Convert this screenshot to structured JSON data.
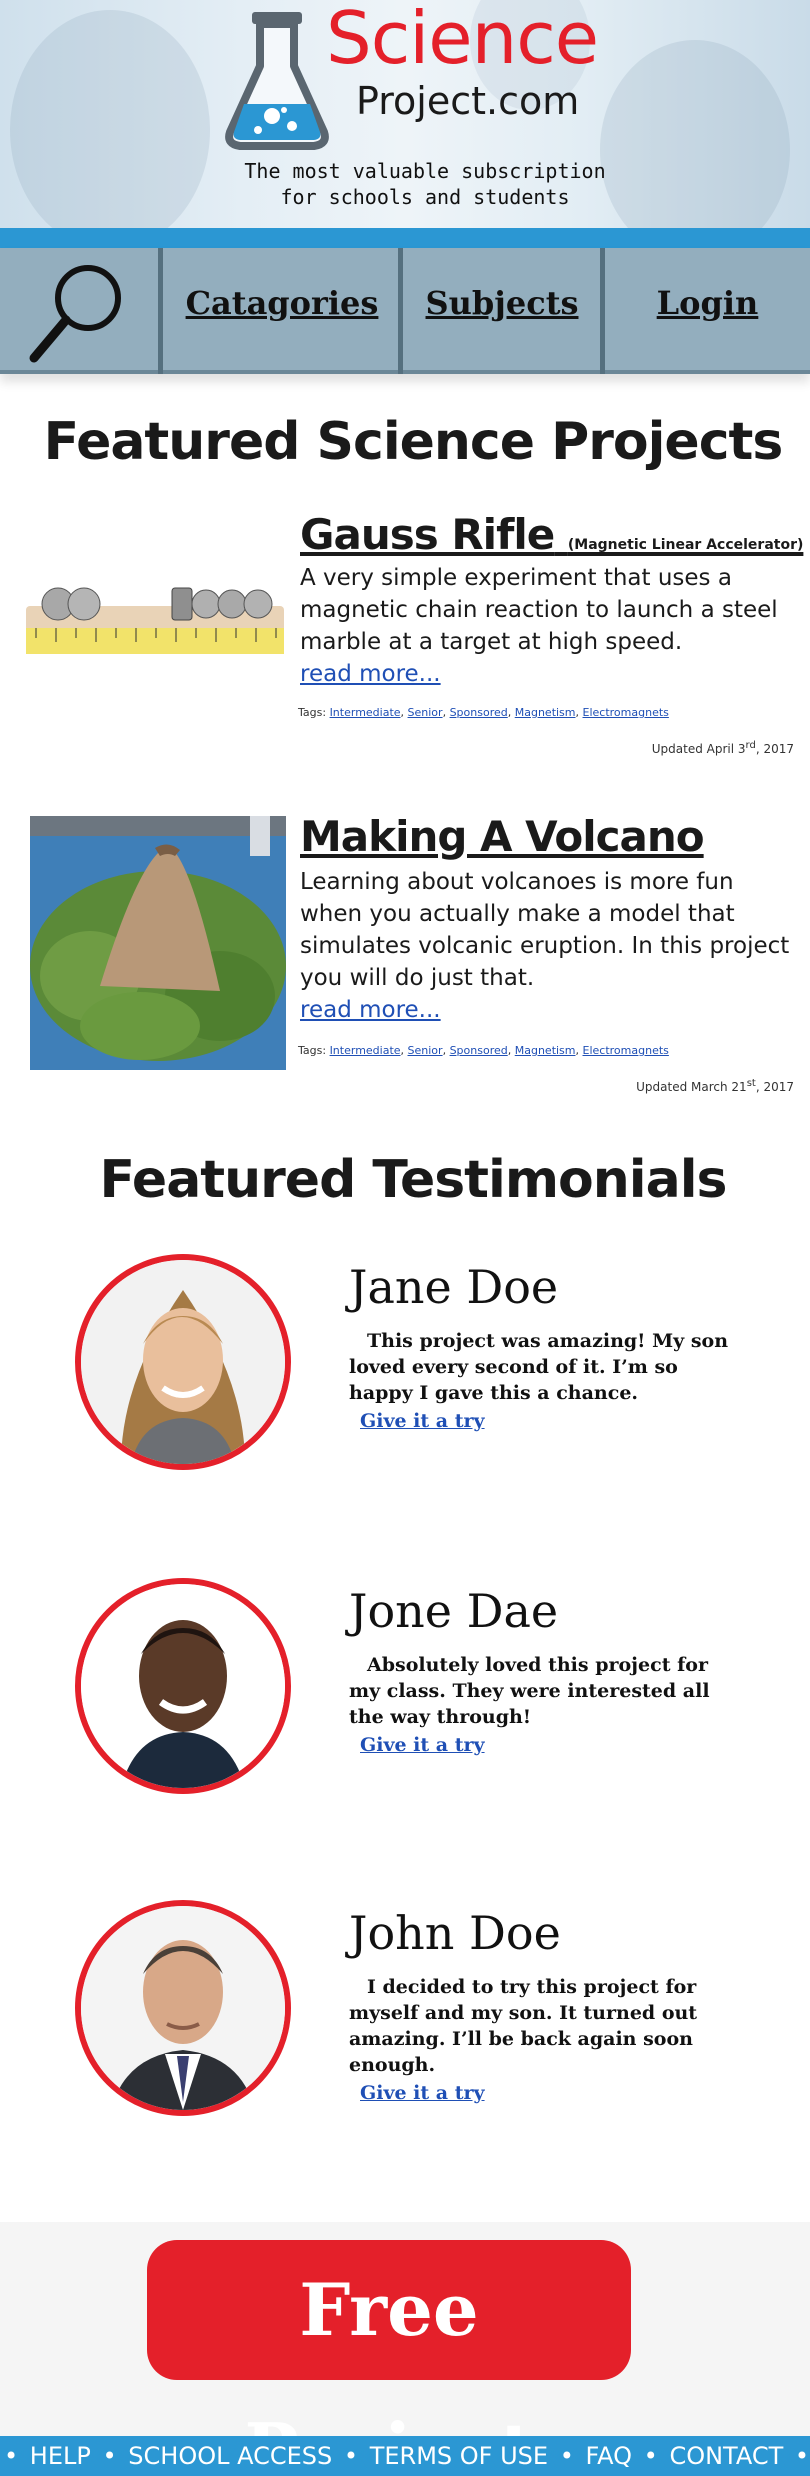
{
  "header": {
    "logo_word1": "Science",
    "logo_word2": "Project.com",
    "tagline_line1": "The most valuable subscription",
    "tagline_line2": "for schools and students"
  },
  "nav": {
    "search_icon": "magnifier-icon",
    "items": [
      {
        "label": "Catagories"
      },
      {
        "label": "Subjects"
      },
      {
        "label": "Login"
      }
    ]
  },
  "featured_projects": {
    "title": "Featured Science Projects",
    "projects": [
      {
        "title": "Gauss Rifle",
        "subtitle": "(Magnetic Linear Accelerator)",
        "description": "A very simple experiment that uses a magnetic chain reaction to launch a steel marble at a target at high speed.",
        "read_more": "read more...",
        "tags_label": "Tags:",
        "tags": [
          "Intermediate",
          "Senior",
          "Sponsored",
          "Magnetism",
          "Electromagnets"
        ],
        "updated_prefix": "Updated April 3",
        "updated_suffix": "rd",
        "updated_year": ",  2017"
      },
      {
        "title": "Making A Volcano",
        "subtitle": "",
        "description": "Learning about volcanoes is more fun when you actually make a model that simulates volcanic eruption. In this project you will do just that.",
        "read_more": "read more...",
        "tags_label": "Tags:",
        "tags": [
          "Intermediate",
          "Senior",
          "Sponsored",
          "Magnetism",
          "Electromagnets"
        ],
        "updated_prefix": "Updated March 21",
        "updated_suffix": "st",
        "updated_year": ",  2017"
      }
    ]
  },
  "testimonials": {
    "title": "Featured Testimonials",
    "items": [
      {
        "name": "Jane Doe",
        "quote": "This project was amazing! My son loved every second of it. I’m so happy I gave this a chance.",
        "link": "Give it a try"
      },
      {
        "name": "Jone Dae",
        "quote": "Absolutely loved this project for my class. They were interested all the way through!",
        "link": "Give it a try"
      },
      {
        "name": "John Doe",
        "quote": "I decided to try this project for myself and my son. It turned out amazing. I’ll be back again soon enough.",
        "link": "Give it a try"
      }
    ]
  },
  "cta": {
    "label": "Free Project"
  },
  "footer": {
    "links": [
      "HELP",
      "SCHOOL ACCESS",
      "TERMS OF USE",
      "FAQ",
      "CONTACT"
    ],
    "separator": "•"
  },
  "colors": {
    "brand_red": "#e4202a",
    "brand_blue": "#2b97d3",
    "nav_bg": "#93aebe",
    "link_blue": "#1f4fb5"
  }
}
